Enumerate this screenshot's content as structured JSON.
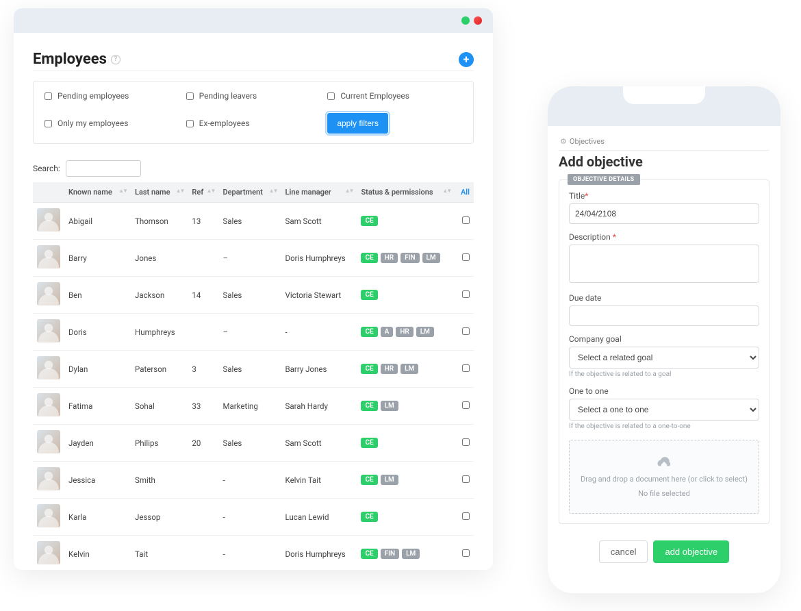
{
  "desktop": {
    "page_title": "Employees",
    "filter": {
      "pending_employees": "Pending employees",
      "pending_leavers": "Pending leavers",
      "current_employees": "Current Employees",
      "only_my_employees": "Only my employees",
      "ex_employees": "Ex-employees",
      "apply_label": "apply filters"
    },
    "search_label": "Search:",
    "search_value": "",
    "columns": {
      "known_name": "Known name",
      "last_name": "Last name",
      "ref": "Ref",
      "department": "Department",
      "line_manager": "Line manager",
      "status": "Status & permissions",
      "all": "All"
    },
    "rows": [
      {
        "known": "Abigail",
        "last": "Thomson",
        "ref": "13",
        "dept": "Sales",
        "mgr": "Sam Scott",
        "badges": [
          "CE"
        ]
      },
      {
        "known": "Barry",
        "last": "Jones",
        "ref": "",
        "dept": "–",
        "mgr": "Doris Humphreys",
        "badges": [
          "CE",
          "HR",
          "FIN",
          "LM"
        ]
      },
      {
        "known": "Ben",
        "last": "Jackson",
        "ref": "14",
        "dept": "Sales",
        "mgr": "Victoria Stewart",
        "badges": [
          "CE"
        ]
      },
      {
        "known": "Doris",
        "last": "Humphreys",
        "ref": "",
        "dept": "–",
        "mgr": "-",
        "badges": [
          "CE",
          "A",
          "HR",
          "LM"
        ]
      },
      {
        "known": "Dylan",
        "last": "Paterson",
        "ref": "3",
        "dept": "Sales",
        "mgr": "Barry Jones",
        "badges": [
          "CE",
          "HR",
          "LM"
        ]
      },
      {
        "known": "Fatima",
        "last": "Sohal",
        "ref": "33",
        "dept": "Marketing",
        "mgr": "Sarah Hardy",
        "badges": [
          "CE",
          "LM"
        ]
      },
      {
        "known": "Jayden",
        "last": "Philips",
        "ref": "20",
        "dept": "Sales",
        "mgr": "Sam Scott",
        "badges": [
          "CE"
        ]
      },
      {
        "known": "Jessica",
        "last": "Smith",
        "ref": "",
        "dept": "-",
        "mgr": "Kelvin Tait",
        "badges": [
          "CE",
          "LM"
        ]
      },
      {
        "known": "Karla",
        "last": "Jessop",
        "ref": "",
        "dept": "-",
        "mgr": "Lucan Lewid",
        "badges": [
          "CE"
        ]
      },
      {
        "known": "Kelvin",
        "last": "Tait",
        "ref": "",
        "dept": "-",
        "mgr": "Doris Humphreys",
        "badges": [
          "CE",
          "FIN",
          "LM"
        ]
      }
    ]
  },
  "mobile": {
    "breadcrumb": "Objectives",
    "heading": "Add objective",
    "panel_legend": "OBJECTIVE DETAILS",
    "title_label": "Title",
    "title_value": "24/04/2108",
    "desc_label": "Description",
    "desc_value": "",
    "due_label": "Due date",
    "due_value": "",
    "goal_label": "Company goal",
    "goal_placeholder": "Select a related goal",
    "goal_hint": "If the objective is related to a goal",
    "one_label": "One to one",
    "one_placeholder": "Select a one to one",
    "one_hint": "If the objective is related to a one-to-one",
    "dropzone_text": "Drag and drop a document here (or click to select)",
    "dropzone_nofile": "No file selected",
    "cancel_label": "cancel",
    "add_label": "add objective"
  }
}
